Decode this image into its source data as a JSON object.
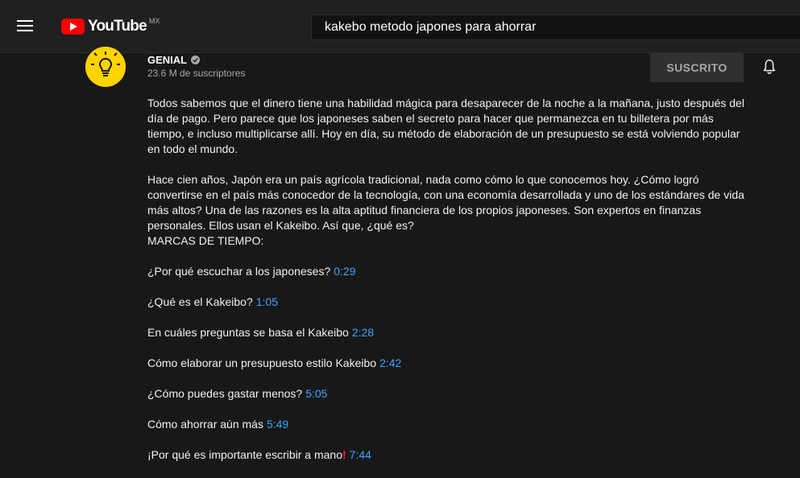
{
  "header": {
    "logo_text": "YouTube",
    "logo_country": "MX",
    "search_value": "kakebo metodo japones para ahorrar"
  },
  "channel": {
    "name": "GENIAL",
    "subscribers": "23.6 M de suscriptores",
    "subscribe_label": "SUSCRITO"
  },
  "description": {
    "paragraph1": "Todos sabemos que el dinero tiene una habilidad mágica para desaparecer de la noche a la mañana, justo después del día de pago. Pero parece que los japoneses saben el secreto para hacer que permanezca en tu billetera por más tiempo, e incluso multiplicarse allí. Hoy en día, su método de elaboración de un presupuesto se está volviendo popular en todo el mundo.",
    "paragraph2": "Hace cien años, Japón era un país agrícola tradicional, nada como cómo lo que conocemos hoy. ¿Cómo logró convertirse en el país más conocedor de la tecnología, con una economía desarrollada y uno de los estándares de vida más altos? Una de las razones es la alta aptitud financiera de los propios japoneses. Son expertos en finanzas personales. Ellos usan el Kakeibo. Así que, ¿qué es?",
    "paragraph2_tail": "MARCAS DE TIEMPO:",
    "timestamps": [
      {
        "text": "¿Por qué escuchar a los japoneses?",
        "time": "0:29"
      },
      {
        "text": "¿Qué es el Kakeibo?",
        "time": "1:05"
      },
      {
        "text": "En cuáles preguntas se basa el Kakeibo",
        "time": "2:28"
      },
      {
        "text": "Cómo elaborar un presupuesto estilo Kakeibo",
        "time": "2:42"
      },
      {
        "text": "¿Cómo puedes gastar menos?",
        "time": "5:05"
      },
      {
        "text": "Cómo ahorrar aún más",
        "time": "5:49"
      },
      {
        "text": "¡Por qué es importante escribir a mano",
        "excl": "!",
        "time": "7:44"
      }
    ]
  },
  "colors": {
    "background": "#181818",
    "header": "#202020",
    "link": "#3ea6ff",
    "brand_red": "#ff0000"
  }
}
